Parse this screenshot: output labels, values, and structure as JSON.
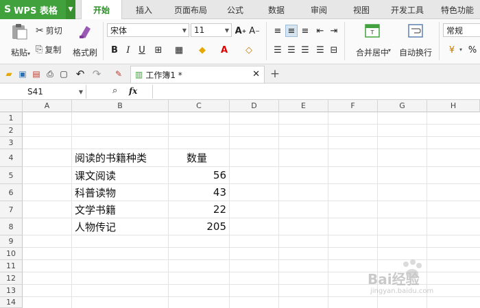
{
  "app": {
    "name": "WPS 表格",
    "logo": "S"
  },
  "menu": {
    "tabs": [
      {
        "label": "开始",
        "active": true
      },
      {
        "label": "插入"
      },
      {
        "label": "页面布局"
      },
      {
        "label": "公式"
      },
      {
        "label": "数据"
      },
      {
        "label": "审阅"
      },
      {
        "label": "视图"
      },
      {
        "label": "开发工具"
      },
      {
        "label": "特色功能"
      }
    ]
  },
  "ribbon": {
    "paste_label": "粘贴",
    "cut_label": "剪切",
    "copy_label": "复制",
    "format_painter_label": "格式刷",
    "font_name": "宋体",
    "font_size": "11",
    "merge_label": "合并居中",
    "wrap_label": "自动换行",
    "number_format": "常规",
    "bold": "B",
    "italic": "I",
    "underline": "U",
    "percent": "%"
  },
  "quickbar": {
    "doc_tab_label": "工作簿1 *"
  },
  "formula_bar": {
    "cell_ref": "S41",
    "fx": "fx"
  },
  "sheet": {
    "columns": [
      "A",
      "B",
      "C",
      "D",
      "E",
      "F",
      "G",
      "H"
    ],
    "rows": [
      "1",
      "2",
      "3",
      "4",
      "5",
      "6",
      "7",
      "8",
      "9",
      "10",
      "11",
      "12",
      "13",
      "14"
    ],
    "cells": {
      "B4": "阅读的书籍种类",
      "C4": "数量",
      "B5": "课文阅读",
      "C5": "56",
      "B6": "科普读物",
      "C6": "43",
      "B7": "文学书籍",
      "C7": "22",
      "B8": "人物传记",
      "C8": "205"
    }
  },
  "watermark": {
    "text": "Bai经验",
    "subtext": "jingyan.baidu.com"
  },
  "colors": {
    "accent": "#41a13c",
    "active_tab_text": "#2a8d24"
  }
}
